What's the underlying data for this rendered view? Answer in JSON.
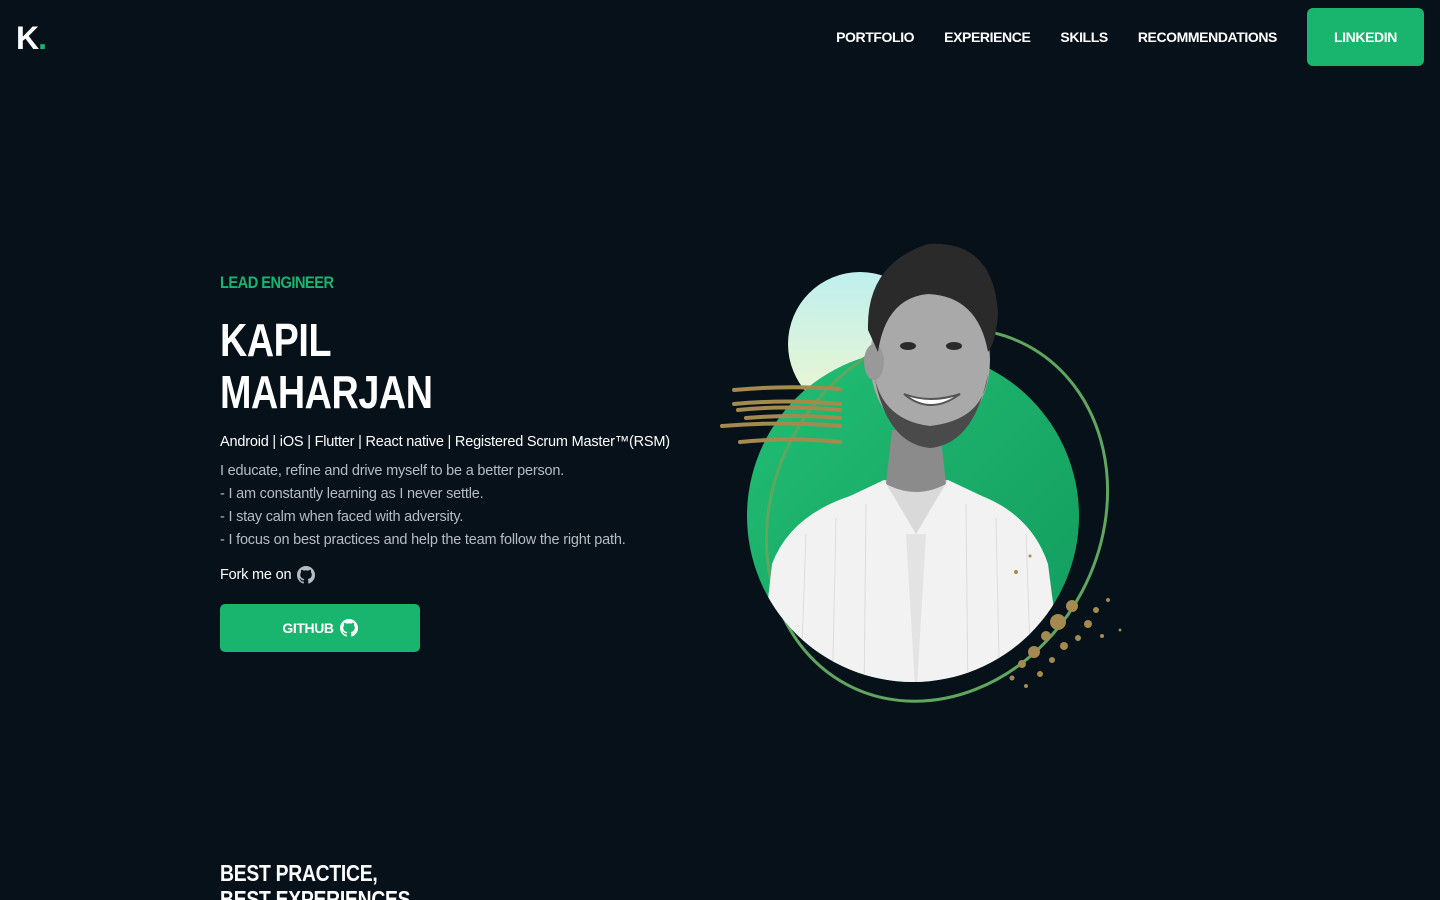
{
  "brand": {
    "letter": "K",
    "dot": "."
  },
  "nav": {
    "links": [
      "PORTFOLIO",
      "EXPERIENCE",
      "SKILLS",
      "RECOMMENDATIONS"
    ],
    "cta": "LINKEDIN"
  },
  "hero": {
    "eyebrow": "LEAD ENGINEER",
    "name_line1": "KAPIL",
    "name_line2": "MAHARJAN",
    "tagline": "Android | iOS | Flutter | React native | Registered Scrum Master™(RSM)",
    "bio": [
      "I educate, refine and drive myself to be a better person.",
      "- I am constantly learning as I never settle.",
      "- I stay calm when faced with adversity.",
      "- I focus on best practices and help the team follow the right path."
    ],
    "fork_label": "Fork me on",
    "github_button": "GITHUB"
  },
  "section": {
    "title_line1": "BEST PRACTICE,",
    "title_line2": "BEST EXPERIENCES"
  },
  "icons": {
    "fork": "github-icon",
    "button": "github-icon"
  },
  "colors": {
    "background": "#07111a",
    "accent": "#19b46e",
    "muted_text": "#b6bcc3",
    "gold": "#a38a4e",
    "ring": "#5fa65f"
  }
}
